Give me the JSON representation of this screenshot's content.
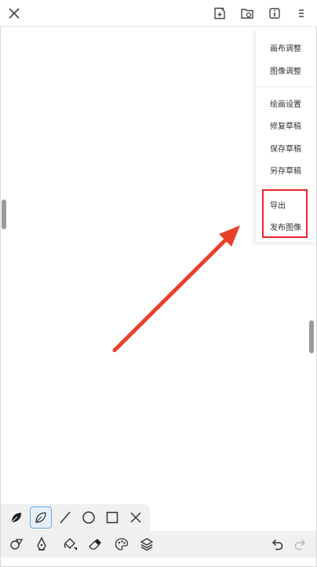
{
  "menu": {
    "items": [
      {
        "label": "画布调整"
      },
      {
        "label": "图像调整"
      },
      {
        "label": "绘画设置"
      },
      {
        "label": "修复草稿"
      },
      {
        "label": "保存草稿"
      },
      {
        "label": "另存草稿"
      },
      {
        "label": "导出"
      },
      {
        "label": "发布图像"
      }
    ]
  },
  "icons": {
    "close": "close-icon",
    "new_canvas": "new-canvas-icon",
    "open_folder": "open-folder-icon",
    "info": "info-icon",
    "more": "more-menu-icon",
    "brush_solid": "leaf-brush-icon",
    "brush_outline": "leaf-outline-brush-icon",
    "line": "line-tool-icon",
    "circle": "circle-tool-icon",
    "rect": "rectangle-tool-icon",
    "clear": "clear-x-icon"
  },
  "colors": {
    "highlight": "#e8262a",
    "active_tool": "#6aa7e0"
  }
}
